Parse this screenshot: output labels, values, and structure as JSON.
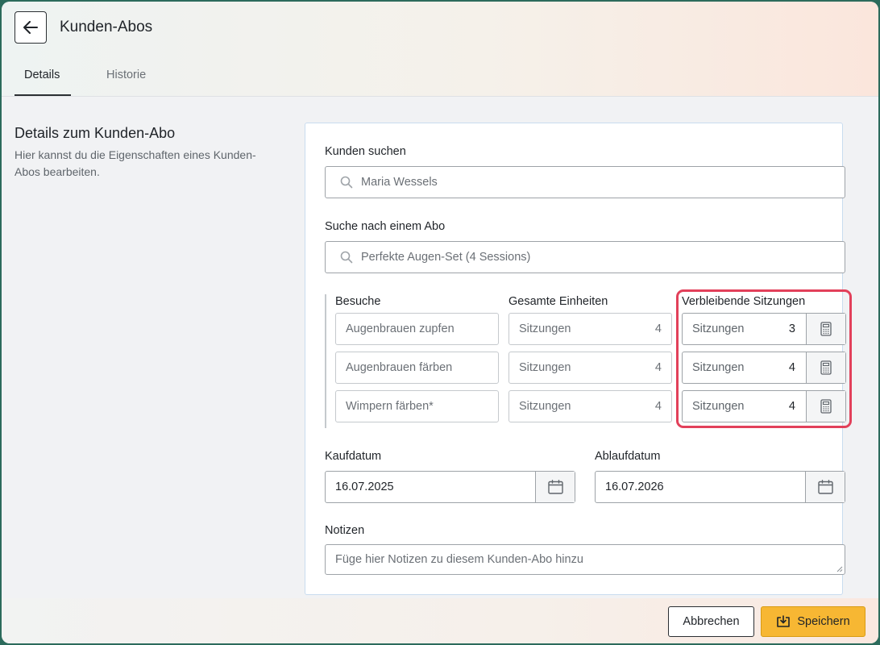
{
  "header": {
    "title": "Kunden-Abos",
    "tabs": [
      {
        "label": "Details",
        "active": true
      },
      {
        "label": "Historie",
        "active": false
      }
    ]
  },
  "section": {
    "title": "Details zum Kunden-Abo",
    "description": "Hier kannst du die Eigenschaften eines Kunden-Abos bearbeiten."
  },
  "form": {
    "customer": {
      "label": "Kunden suchen",
      "value": "Maria Wessels"
    },
    "subscription": {
      "label": "Suche nach einem Abo",
      "value": "Perfekte Augen-Set (4 Sessions)"
    },
    "columns": {
      "visits": "Besuche",
      "total_units": "Gesamte Einheiten",
      "remaining": "Verbleibende Sitzungen"
    },
    "rows": [
      {
        "service": "Augenbrauen zupfen",
        "unit_label": "Sitzungen",
        "total": "4",
        "remaining_label": "Sitzungen",
        "remaining": "3"
      },
      {
        "service": "Augenbrauen färben",
        "unit_label": "Sitzungen",
        "total": "4",
        "remaining_label": "Sitzungen",
        "remaining": "4"
      },
      {
        "service": "Wimpern färben*",
        "unit_label": "Sitzungen",
        "total": "4",
        "remaining_label": "Sitzungen",
        "remaining": "4"
      }
    ],
    "purchase_date": {
      "label": "Kaufdatum",
      "value": "16.07.2025"
    },
    "expiry_date": {
      "label": "Ablaufdatum",
      "value": "16.07.2026"
    },
    "notes": {
      "label": "Notizen",
      "placeholder": "Füge hier Notizen zu diesem Kunden-Abo hinzu"
    }
  },
  "footer": {
    "cancel_label": "Abbrechen",
    "save_label": "Speichern"
  },
  "colors": {
    "accent_save": "#f7b733",
    "highlight": "#e2405a"
  },
  "icons": [
    "arrow-left-icon",
    "search-icon",
    "calculator-icon",
    "calendar-icon",
    "save-icon",
    "resize-grip-icon"
  ]
}
